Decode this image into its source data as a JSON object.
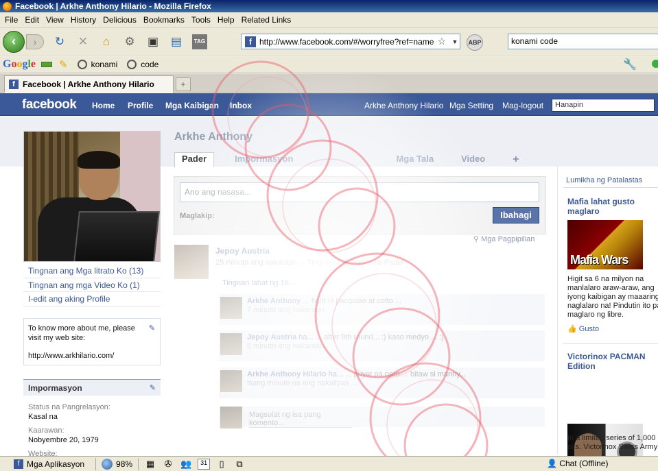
{
  "window": {
    "title": "Facebook | Arkhe Anthony Hilario - Mozilla Firefox"
  },
  "menu": [
    "File",
    "Edit",
    "View",
    "History",
    "Delicious",
    "Bookmarks",
    "Tools",
    "Help",
    "Related Links"
  ],
  "nav": {
    "url": "http://www.facebook.com/#/worryfree?ref=name",
    "search_value": "konami code",
    "abp_label": "ABP",
    "tag_label": "TAG"
  },
  "google_toolbar": {
    "items": [
      "konami",
      "code"
    ]
  },
  "tab": {
    "title": "Facebook | Arkhe Anthony Hilario"
  },
  "fb": {
    "logo": "facebook",
    "left_nav": [
      "Home",
      "Profile",
      "Mga Kaibigan",
      "Inbox"
    ],
    "right_nav": [
      "Arkhe Anthony Hilario",
      "Mga Setting",
      "Mag-logout"
    ],
    "search_placeholder": "Hanapin"
  },
  "profile": {
    "name": "Arkhe Anthony",
    "links": [
      "Tingnan ang Mga litrato Ko (13)",
      "Tingnan ang mga Video Ko (1)",
      "I-edit ang aking Profile"
    ],
    "bio": "To know more about me, please visit my web site:",
    "bio_url": "http://www.arkhilario.com/",
    "info_title": "Impormasyon",
    "info": [
      {
        "label": "Status na Pangrelasyon:",
        "value": "Kasal na"
      },
      {
        "label": "Kaarawan:",
        "value": "Nobyembre 20, 1979"
      },
      {
        "label": "Website:",
        "value": ""
      }
    ]
  },
  "main": {
    "tabs": [
      "Pader",
      "Impormasyon",
      "",
      "Mga Tala",
      "Video",
      "+"
    ],
    "publisher_placeholder": "Ano ang nasasa...",
    "attach_label": "Maglakip:",
    "share_button": "Ibahagi",
    "filter_label": "Mga Pagpipilian",
    "story": {
      "author": "Jepoy Austria",
      "meta": "25 minuto ang nakaraan ... Tingnan ang Pader-sa-Pader",
      "subtitle": "Tingnan lahat ng 16 ...",
      "comments": [
        {
          "author": "Arkhe Anthony",
          "text": "... fight ni pacquiao at cotto ...",
          "time": "7 minuto ang nakaraan"
        },
        {
          "author": "Jepoy Austria",
          "text": "ha... ... after 9th round... :) kaso medyo ... :)",
          "time": "5 minuto ang nakaraan"
        },
        {
          "author": "Arkhe Anthony Hilario",
          "text": "ha... ... puyat pa pero ... bitaw si manny...",
          "time": "isang minuto na ang nakalipas ..."
        }
      ],
      "write_comment": "Magsulat ng isa pang komento..."
    }
  },
  "ads": {
    "create": "Lumikha ng Patalastas",
    "ad1": {
      "title": "Mafia lahat gusto maglaro",
      "image_text": "Mafia Wars",
      "body": [
        "Higit sa 6 na milyon na",
        "manlalaro araw-araw, ang",
        "iyong kaibigan ay maaaring",
        "naglalaro na! Pindutin ito para",
        "maglaro ng libre."
      ],
      "like": "Gusto"
    },
    "ad2": {
      "title": "Victorinox PACMAN Edition",
      "body": [
        "In a limited series of 1,000",
        "pcs. Victorinox Swiss Army"
      ]
    }
  },
  "status": {
    "apps": "Mga Aplikasyon",
    "zoom": "98%",
    "chat": "Chat (Offline)",
    "calendar_day": "31"
  }
}
